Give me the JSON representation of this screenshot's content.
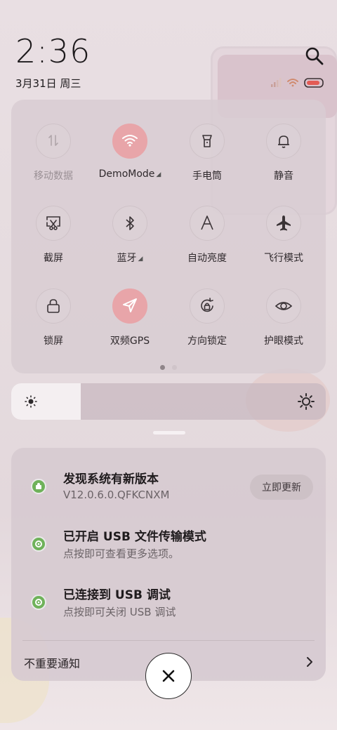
{
  "status": {
    "time": "2:36",
    "date": "3月31日 周三",
    "search_icon": "search-icon"
  },
  "quick_settings": [
    {
      "label": "移动数据",
      "icon": "mobile-data-icon",
      "active": false,
      "dim": true,
      "caret": false
    },
    {
      "label": "DemoMode",
      "icon": "wifi-icon",
      "active": true,
      "dim": false,
      "caret": true
    },
    {
      "label": "手电筒",
      "icon": "flashlight-icon",
      "active": false,
      "dim": false,
      "caret": false
    },
    {
      "label": "静音",
      "icon": "bell-icon",
      "active": false,
      "dim": false,
      "caret": false
    },
    {
      "label": "截屏",
      "icon": "screenshot-icon",
      "active": false,
      "dim": false,
      "caret": false
    },
    {
      "label": "蓝牙",
      "icon": "bluetooth-icon",
      "active": false,
      "dim": false,
      "caret": true
    },
    {
      "label": "自动亮度",
      "icon": "auto-brightness-icon",
      "active": false,
      "dim": false,
      "caret": false
    },
    {
      "label": "飞行模式",
      "icon": "airplane-icon",
      "active": false,
      "dim": false,
      "caret": false
    },
    {
      "label": "锁屏",
      "icon": "lock-icon",
      "active": false,
      "dim": false,
      "caret": false
    },
    {
      "label": "双频GPS",
      "icon": "gps-icon",
      "active": true,
      "dim": false,
      "caret": false
    },
    {
      "label": "方向锁定",
      "icon": "rotation-lock-icon",
      "active": false,
      "dim": false,
      "caret": false
    },
    {
      "label": "护眼模式",
      "icon": "eye-icon",
      "active": false,
      "dim": false,
      "caret": false
    }
  ],
  "page_indicator": {
    "current": 1,
    "total": 2
  },
  "brightness": {
    "level": 0.22
  },
  "notifications": [
    {
      "title": "发现系统有新版本",
      "subtitle": "V12.0.6.0.QFKCNXM",
      "action": "立即更新"
    },
    {
      "title": "已开启 USB 文件传输模式",
      "subtitle": "点按即可查看更多选项。"
    },
    {
      "title": "已连接到 USB 调试",
      "subtitle": "点按即可关闭 USB 调试"
    }
  ],
  "unimportant_label": "不重要通知",
  "colors": {
    "accent_active": "#e8a5a9",
    "notif_icon": "#6fb25a"
  }
}
